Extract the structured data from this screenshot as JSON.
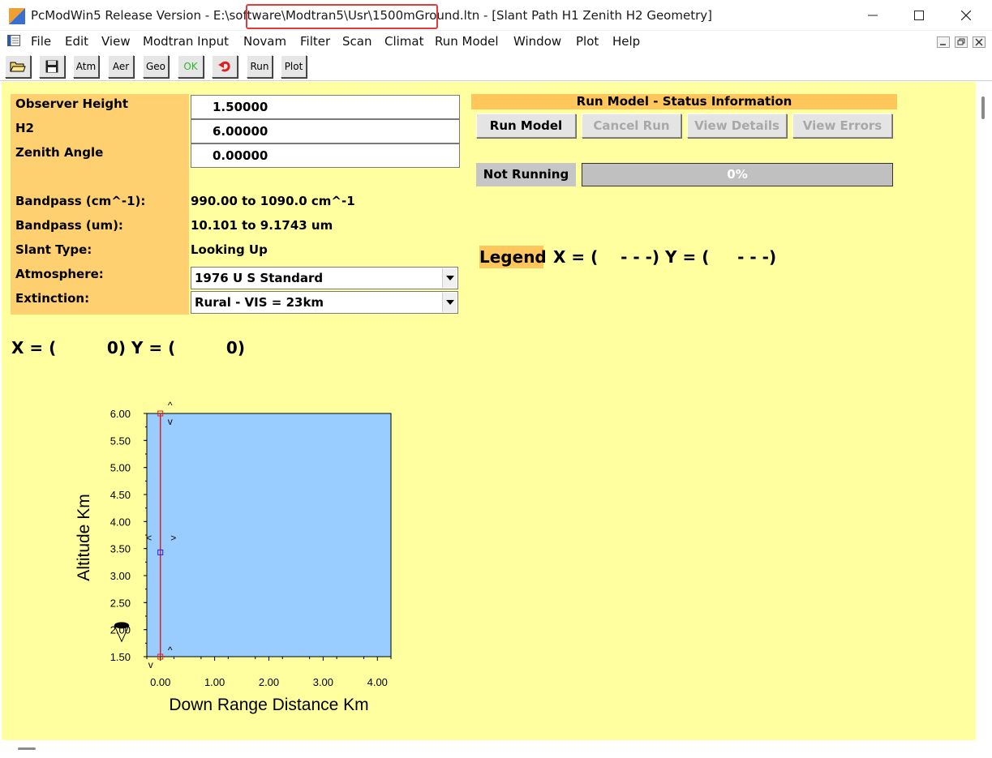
{
  "window": {
    "title_prefix": "PcModWin5 Release Version - E:\\software",
    "title_path": "\\Modtran5\\Usr\\1500mGround.ltn",
    "title_suffix": "[Slant Path H1 Zenith H2 Geometry]"
  },
  "menu": [
    "File",
    "Edit",
    "View",
    "Modtran Input",
    "Novam",
    "Filter",
    "Scan",
    "Climat",
    "Run Model",
    "Window",
    "Plot",
    "Help"
  ],
  "toolbar": {
    "open_icon": "folder-open-icon",
    "save_icon": "floppy-disk-icon",
    "atm": "Atm",
    "aer": "Aer",
    "geo": "Geo",
    "ok": "OK",
    "undo_icon": "undo-arrow-icon",
    "run": "Run",
    "plot": "Plot"
  },
  "form": {
    "observer_height_label": "Observer Height",
    "observer_height_value": "1.50000",
    "h2_label": "H2",
    "h2_value": "6.00000",
    "zenith_angle_label": "Zenith Angle",
    "zenith_angle_value": "0.00000",
    "bandpass_cm_label": "Bandpass (cm^-1):",
    "bandpass_cm_value": "990.00 to 1090.0 cm^-1",
    "bandpass_um_label": "Bandpass (um):",
    "bandpass_um_value": "10.101 to 9.1743 um",
    "slant_type_label": "Slant Type:",
    "slant_type_value": "Looking Up",
    "atmosphere_label": "Atmosphere:",
    "atmosphere_value": "1976 U S Standard",
    "extinction_label": "Extinction:",
    "extinction_value": "Rural - VIS = 23km"
  },
  "status": {
    "header": "Run Model - Status Information",
    "run_model": "Run Model",
    "cancel_run": "Cancel Run",
    "view_details": "View Details",
    "view_errors": "View Errors",
    "state": "Not Running",
    "progress_text": "0%",
    "progress_fraction": 0
  },
  "legend": {
    "label": "Legend",
    "xy": "X = (    - - -) Y = (     - - -)"
  },
  "readout": "X = (         0) Y = (         0)",
  "colors": {
    "panel_bg": "#ffffa0",
    "label_bg": "#ffd070",
    "plot_fill": "#99ccff",
    "path_line": "#e02020"
  },
  "chart_data": {
    "type": "line",
    "xlabel": "Down Range Distance Km",
    "ylabel": "Altitude Km",
    "xlim": [
      -0.25,
      4.25
    ],
    "ylim": [
      1.5,
      6.0
    ],
    "x_ticks": [
      "0.00",
      "1.00",
      "2.00",
      "3.00",
      "4.00"
    ],
    "x_tick_values": [
      0,
      1,
      2,
      3,
      4
    ],
    "y_ticks": [
      "6.00",
      "5.50",
      "5.00",
      "4.50",
      "4.00",
      "3.50",
      "3.00",
      "2.50",
      "2.00",
      "1.50"
    ],
    "y_tick_values": [
      6.0,
      5.5,
      5.0,
      4.5,
      4.0,
      3.5,
      3.0,
      2.5,
      2.0,
      1.5
    ],
    "series": [
      {
        "x": [
          0,
          0
        ],
        "y": [
          1.5,
          6.0
        ]
      }
    ],
    "markers": {
      "observer_altitude": 1.5,
      "h2_altitude": 6.0,
      "mid_altitude": 3.43
    }
  }
}
